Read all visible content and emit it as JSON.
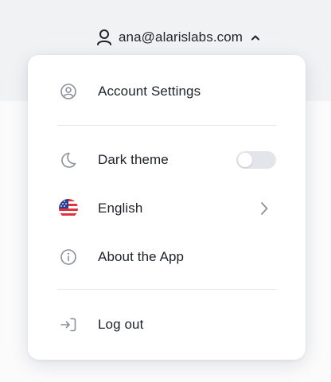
{
  "header": {
    "email": "ana@alarislabs.com",
    "user_icon": "user-icon",
    "toggle_icon": "chevron-up-icon"
  },
  "menu": {
    "account_settings": {
      "label": "Account Settings",
      "icon": "user-circle-icon"
    },
    "dark_theme": {
      "label": "Dark theme",
      "icon": "moon-icon",
      "enabled": false
    },
    "language": {
      "label": "English",
      "icon": "us-flag-icon",
      "submenu_icon": "chevron-right-icon"
    },
    "about": {
      "label": "About the App",
      "icon": "info-icon"
    },
    "logout": {
      "label": "Log out",
      "icon": "logout-icon"
    }
  },
  "colors": {
    "icon_gray": "#8b9099",
    "text": "#1e2227",
    "toggle_off": "#e3e5ea"
  }
}
